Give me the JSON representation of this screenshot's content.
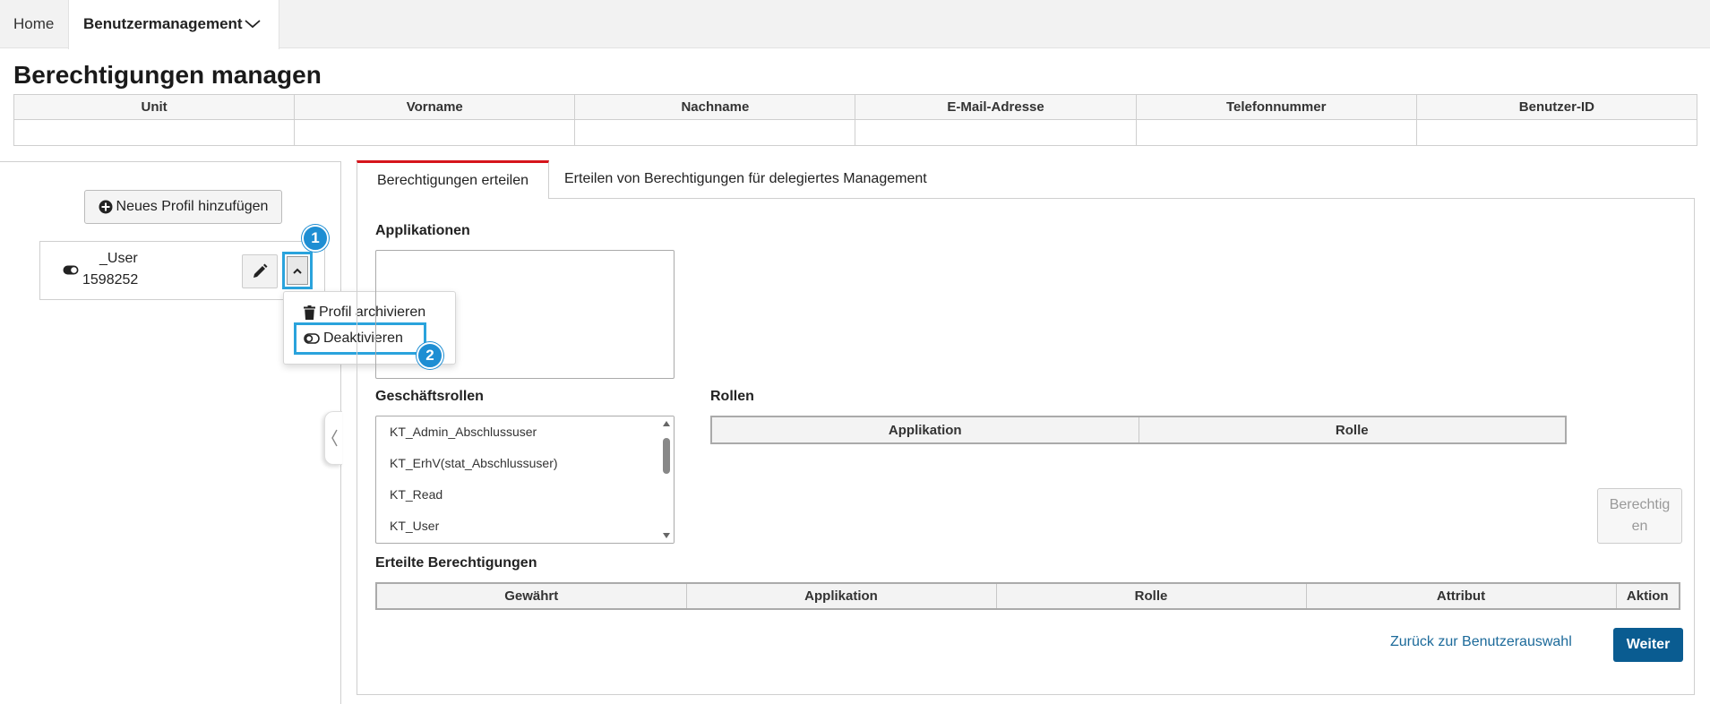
{
  "nav": {
    "home": "Home",
    "user_management": "Benutzermanagement"
  },
  "page_title": "Berechtigungen managen",
  "user_table": {
    "columns": [
      "Unit",
      "Vorname",
      "Nachname",
      "E-Mail-Adresse",
      "Telefonnummer",
      "Benutzer-ID"
    ]
  },
  "left": {
    "add_profile_label": "Neues Profil hinzufügen",
    "profile": {
      "name": "_User",
      "id": "1598252"
    },
    "menu": {
      "archive": "Profil archivieren",
      "deactivate": "Deaktivieren"
    },
    "badges": {
      "one": "1",
      "two": "2"
    }
  },
  "tabs": {
    "active": "Berechtigungen erteilen",
    "inactive": "Erteilen von Berechtigungen für delegiertes Management"
  },
  "sections": {
    "applications": "Applikationen",
    "business_roles": "Geschäftsrollen",
    "roles": "Rollen",
    "granted": "Erteilte Berechtigungen"
  },
  "business_roles": [
    "KT_Admin_Abschlussuser",
    "KT_ErhV(stat_Abschlussuser)",
    "KT_Read",
    "KT_User"
  ],
  "roles_table": {
    "columns": [
      "Applikation",
      "Rolle"
    ]
  },
  "granted_table": {
    "columns": [
      "Gewährt",
      "Applikation",
      "Rolle",
      "Attribut",
      "Aktion"
    ]
  },
  "buttons": {
    "authorize": "Berechtigen",
    "back": "Zurück zur Benutzerauswahl",
    "next": "Weiter"
  },
  "colors": {
    "accent_tab": "#d6141b",
    "primary_button": "#0a5c91",
    "highlight": "#2aa3dc",
    "link": "#1c6a9a"
  }
}
